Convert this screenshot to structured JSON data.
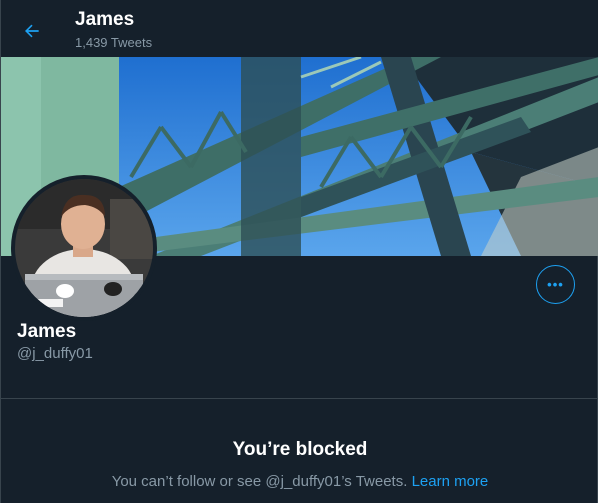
{
  "header": {
    "name": "James",
    "tweet_count": "1,439 Tweets"
  },
  "profile": {
    "name": "James",
    "handle": "@j_duffy01"
  },
  "blocked": {
    "title": "You’re blocked",
    "message_prefix": "You can’t follow or see @j_duffy01’s Tweets.",
    "link_text": "Learn more"
  },
  "icons": {
    "back": "arrow-left-icon",
    "more": "more-horizontal-icon"
  },
  "colors": {
    "background": "#15202b",
    "accent": "#1da1f2",
    "secondary_text": "#8899a6",
    "border": "#38444d"
  }
}
